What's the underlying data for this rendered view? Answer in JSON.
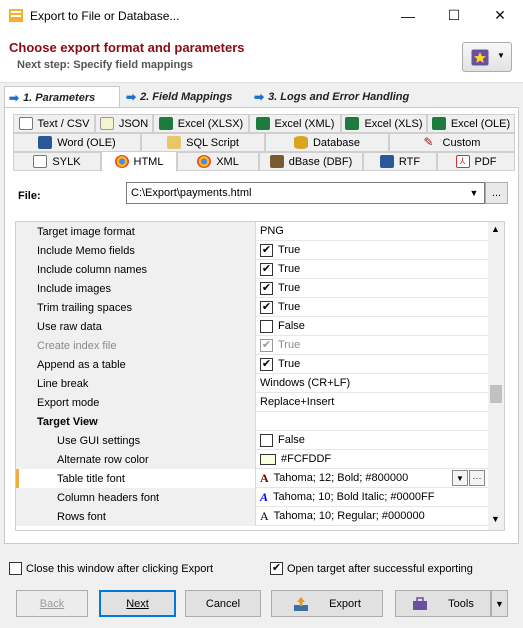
{
  "window": {
    "title": "Export to File or Database...",
    "minimize": "—",
    "maximize": "☐",
    "close": "✕"
  },
  "header": {
    "title": "Choose export format and parameters",
    "subtitle": "Next step: Specify field mappings"
  },
  "steps": [
    {
      "label": "1. Parameters"
    },
    {
      "label": "2. Field Mappings"
    },
    {
      "label": "3. Logs and Error Handling"
    }
  ],
  "tabs": {
    "row1": [
      "Text / CSV",
      "JSON",
      "Excel (XLSX)",
      "Excel (XML)",
      "Excel (XLS)",
      "Excel (OLE)"
    ],
    "row2": [
      "Word (OLE)",
      "SQL Script",
      "Database",
      "Custom"
    ],
    "row3": [
      "SYLK",
      "HTML",
      "XML",
      "dBase (DBF)",
      "RTF",
      "PDF"
    ]
  },
  "file": {
    "label": "File:",
    "value": "C:\\Export\\payments.html",
    "browse": "..."
  },
  "properties": [
    {
      "name": "Target image format",
      "value": "PNG"
    },
    {
      "name": "Include Memo fields",
      "check": true,
      "value": "True"
    },
    {
      "name": "Include column names",
      "check": true,
      "value": "True"
    },
    {
      "name": "Include images",
      "check": true,
      "value": "True"
    },
    {
      "name": "Trim trailing spaces",
      "check": true,
      "value": "True"
    },
    {
      "name": "Use raw data",
      "check": false,
      "value": "False"
    },
    {
      "name": "Create index file",
      "check": true,
      "value": "True"
    },
    {
      "name": "Append as a table",
      "check": true,
      "value": "True"
    },
    {
      "name": "Line break",
      "value": "Windows (CR+LF)"
    },
    {
      "name": "Export mode",
      "value": "Replace+Insert"
    },
    {
      "name": "Target View",
      "value": ""
    },
    {
      "name": "Use GUI settings",
      "check": false,
      "value": "False"
    },
    {
      "name": "Alternate row color",
      "value": "#FCFDDF"
    },
    {
      "name": "Table title font",
      "value": "Tahoma; 12; Bold; #800000"
    },
    {
      "name": "Column headers font",
      "value": "Tahoma; 10; Bold Italic; #0000FF"
    },
    {
      "name": "Rows font",
      "value": "Tahoma; 10; Regular; #000000"
    }
  ],
  "bottom": {
    "close_after": "Close this window after clicking Export",
    "open_target": "Open target after successful exporting"
  },
  "buttons": {
    "back": "Back",
    "next": "Next",
    "cancel": "Cancel",
    "export": "Export",
    "tools": "Tools"
  },
  "colors": {
    "title_red": "#8b0a14",
    "accent": "#0078d7",
    "check_green": "#2a8a2a",
    "alt_row": "#FCFDDF"
  }
}
